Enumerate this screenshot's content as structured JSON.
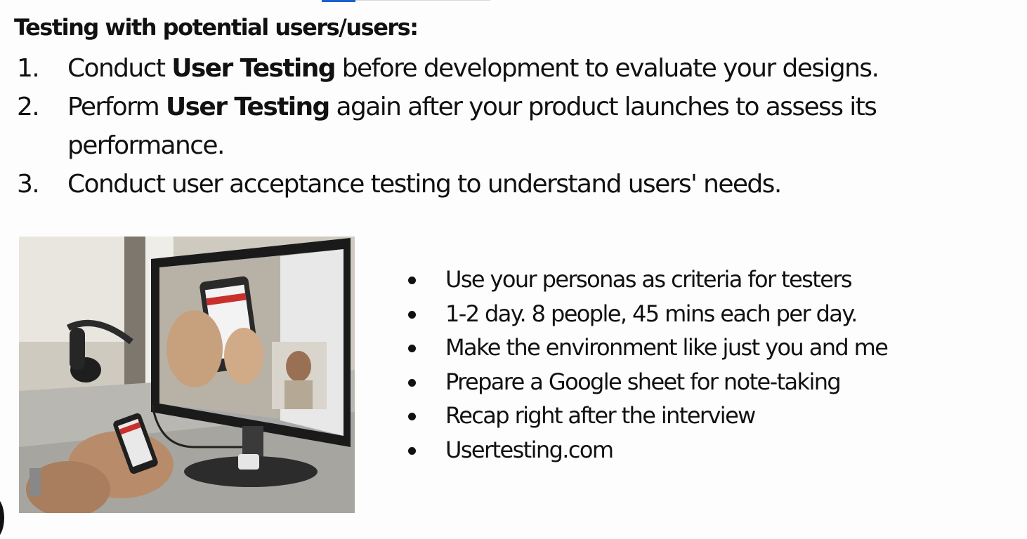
{
  "heading": "Testing with potential users/users:",
  "steps": [
    {
      "num": "1.",
      "pre": "Conduct ",
      "bold": "User Testing",
      "post": " before development to evaluate your designs."
    },
    {
      "num": "2.",
      "pre": "Perform ",
      "bold": "User Testing",
      "post": " again after your product launches to assess its performance."
    },
    {
      "num": "3.",
      "pre": "Conduct user acceptance testing to understand users' needs.",
      "bold": "",
      "post": ""
    }
  ],
  "bullets": [
    "Use your personas as criteria for testers",
    "1-2 day. 8 people, 45 mins each per day.",
    "Make the environment like just you and me",
    "Prepare a Google sheet for note-taking",
    "Recap right after the interview",
    "Usertesting.com"
  ],
  "colors": {
    "background": "#fdfdfd",
    "text": "#111111",
    "accent": "#1d5fd1"
  },
  "image": {
    "subject": "user testing setup: hands holding a smartphone mirrored on a desktop monitor with webcam"
  }
}
